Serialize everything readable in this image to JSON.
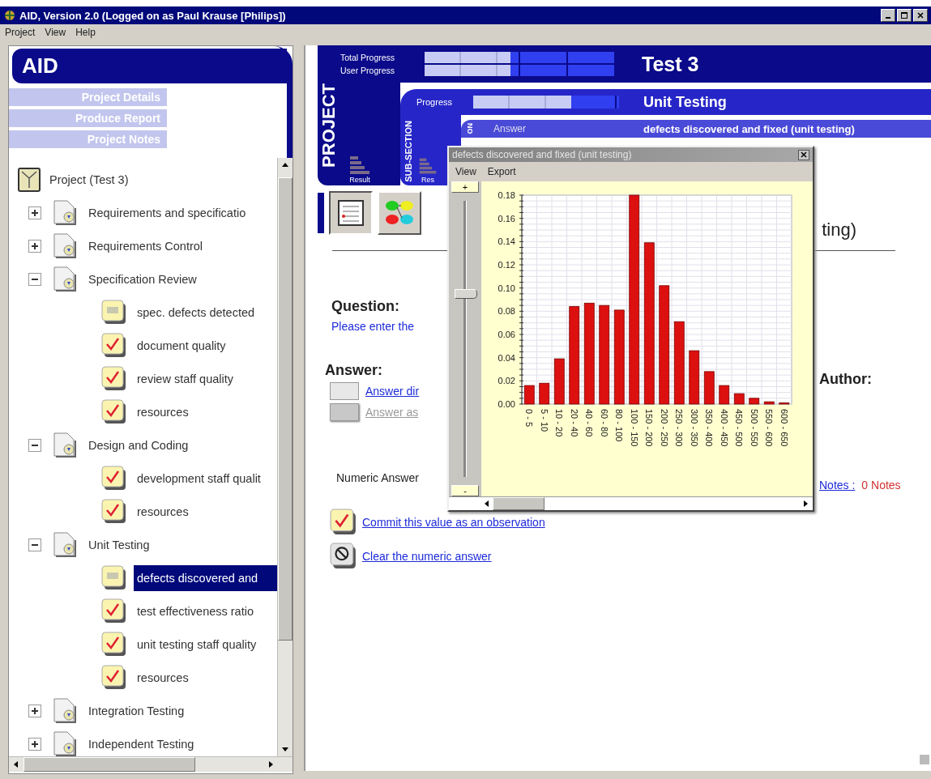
{
  "window": {
    "title": "AID, Version 2.0 (Logged on as Paul Krause [Philips])"
  },
  "menu": [
    "Project",
    "View",
    "Help"
  ],
  "sidebar": {
    "title": "AID",
    "links": [
      "Project Details",
      "Produce Report",
      "Project Notes"
    ],
    "tree": {
      "label": "Project (Test 3)",
      "selected": false,
      "children": [
        {
          "label": "Requirements and specificatio",
          "expanded": false,
          "selected": false
        },
        {
          "label": "Requirements Control",
          "expanded": false,
          "selected": false
        },
        {
          "label": "Specification Review",
          "expanded": true,
          "selected": false,
          "children": [
            {
              "label": "spec. defects detected",
              "answered": false,
              "selected": false
            },
            {
              "label": "document quality",
              "answered": true,
              "selected": false
            },
            {
              "label": "review staff quality",
              "answered": true,
              "selected": false
            },
            {
              "label": "resources",
              "answered": true,
              "selected": false
            }
          ]
        },
        {
          "label": "Design and Coding",
          "expanded": true,
          "selected": false,
          "children": [
            {
              "label": "development staff qualit",
              "answered": true,
              "selected": false
            },
            {
              "label": "resources",
              "answered": true,
              "selected": false
            }
          ]
        },
        {
          "label": "Unit Testing",
          "expanded": true,
          "selected": false,
          "children": [
            {
              "label": "defects discovered and",
              "answered": false,
              "selected": true
            },
            {
              "label": "test effectiveness ratio",
              "answered": true,
              "selected": false
            },
            {
              "label": "unit testing staff quality",
              "answered": true,
              "selected": false
            },
            {
              "label": "resources",
              "answered": true,
              "selected": false
            }
          ]
        },
        {
          "label": "Integration Testing",
          "expanded": false,
          "selected": false
        },
        {
          "label": "Independent Testing",
          "expanded": false,
          "selected": false
        }
      ]
    }
  },
  "header": {
    "section_tab": "PROJECT",
    "title": "Test 3",
    "result": "Result",
    "progress": [
      {
        "label": "Total Progress",
        "level": 0.45
      },
      {
        "label": "User Progress",
        "level": 0.45
      }
    ],
    "subsection": {
      "tab": "SUB-SECTION",
      "progress_label": "Progress",
      "level": 0.67,
      "title": "Unit Testing",
      "result": "Res"
    },
    "question": {
      "tab": "ON",
      "label": "Answer",
      "title": "defects discovered and fixed (unit testing)"
    }
  },
  "page": {
    "heading": "ting)",
    "question_label": "Question:",
    "question_text": "Please enter the",
    "answer_label": "Answer:",
    "answer_options": [
      {
        "label": "Answer dir",
        "disabled": false
      },
      {
        "label": "Answer as",
        "disabled": true
      }
    ],
    "numeric_answer_label": "Numeric Answer",
    "author_label": "Author:",
    "notes_link": "Notes :",
    "notes_count": "0 Notes",
    "actions": [
      {
        "kind": "commit",
        "label": "Commit this value as an observation"
      },
      {
        "kind": "clear",
        "label": "Clear the numeric answer"
      }
    ]
  },
  "chart_window": {
    "title": "defects discovered and fixed (unit testing)",
    "menu": [
      "View",
      "Export"
    ],
    "zoom_in": "+",
    "zoom_out": "-",
    "level": 0.66,
    "chart_data": {
      "type": "bar",
      "categories": [
        "0 - 5",
        "5 - 10",
        "10 - 20",
        "20 - 40",
        "40 - 60",
        "60 - 80",
        "80 - 100",
        "100 - 150",
        "150 - 200",
        "200 - 250",
        "250 - 300",
        "300 - 350",
        "350 - 400",
        "400 - 450",
        "450 - 500",
        "500 - 550",
        "550 - 600",
        "600 - 650"
      ],
      "values": [
        0.016,
        0.018,
        0.039,
        0.084,
        0.087,
        0.085,
        0.081,
        0.18,
        0.139,
        0.102,
        0.071,
        0.046,
        0.028,
        0.016,
        0.009,
        0.005,
        0.002,
        0.001
      ],
      "ylim": [
        0,
        0.18
      ],
      "grid": true,
      "yticks": [
        {
          "value": 0,
          "label": "0.00"
        },
        {
          "value": 0.02,
          "label": "0.02"
        },
        {
          "value": 0.04,
          "label": "0.04"
        },
        {
          "value": 0.06,
          "label": "0.06"
        },
        {
          "value": 0.08,
          "label": "0.08"
        },
        {
          "value": 0.1,
          "label": "0.10"
        },
        {
          "value": 0.12,
          "label": "0.12"
        },
        {
          "value": 0.14,
          "label": "0.14"
        },
        {
          "value": 0.16,
          "label": "0.16"
        },
        {
          "value": 0.18,
          "label": "0.18"
        }
      ]
    }
  }
}
